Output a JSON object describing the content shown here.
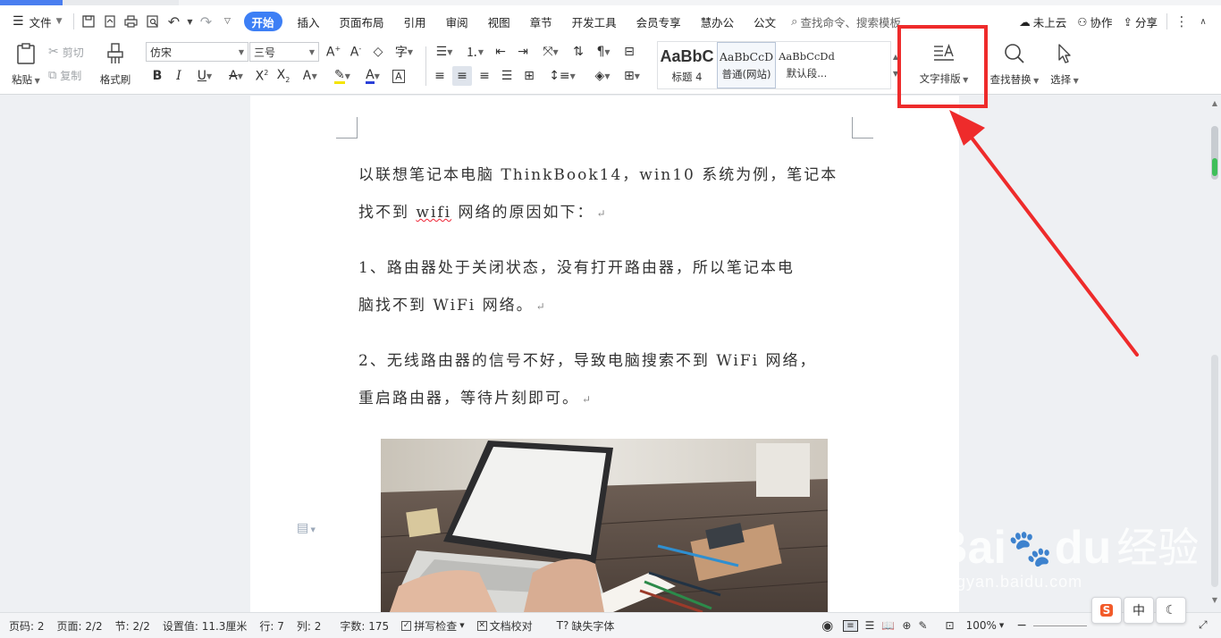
{
  "menubar": {
    "file_label": "文件",
    "tabs": [
      {
        "label": "开始",
        "active": true
      },
      {
        "label": "插入"
      },
      {
        "label": "页面布局"
      },
      {
        "label": "引用"
      },
      {
        "label": "审阅"
      },
      {
        "label": "视图"
      },
      {
        "label": "章节"
      },
      {
        "label": "开发工具"
      },
      {
        "label": "会员专享"
      },
      {
        "label": "慧办公"
      },
      {
        "label": "公文"
      }
    ],
    "search_label": "查找命令、搜索模板",
    "cloud_label": "未上云",
    "collab_label": "协作",
    "share_label": "分享"
  },
  "ribbon": {
    "paste_label": "粘贴",
    "cut_label": "剪切",
    "copy_label": "复制",
    "format_painter_label": "格式刷",
    "font_name": "仿宋",
    "font_size": "三号",
    "styles": [
      {
        "preview": "AaBbC",
        "name": "标题 4"
      },
      {
        "preview": "AaBbCcD",
        "name": "普通(网站)"
      },
      {
        "preview": "AaBbCcDd",
        "name": "默认段..."
      }
    ],
    "text_layout_label": "文字排版",
    "find_replace_label": "查找替换",
    "select_label": "选择"
  },
  "document": {
    "p1_line1": "以联想笔记本电脑 ThinkBook14，win10 系统为例，笔记本",
    "p1_line2_pre": "找不到 ",
    "p1_line2_wifi": "wifi",
    "p1_line2_post": " 网络的原因如下：",
    "p2_line1": "1、路由器处于关闭状态，没有打开路由器，所以笔记本电",
    "p2_line2": "脑找不到 WiFi 网络。",
    "p3_line1": "2、无线路由器的信号不好，导致电脑搜索不到 WiFi 网络，",
    "p3_line2": "重启路由器，等待片刻即可。",
    "return_mark": "↵"
  },
  "statusbar": {
    "page_num": "页码: 2",
    "pages": "页面: 2/2",
    "section": "节: 2/2",
    "setting": "设置值: 11.3厘米",
    "row": "行: 7",
    "col": "列: 2",
    "words": "字数: 175",
    "spell_check": "拼写检查",
    "doc_proof": "文档校对",
    "missing_font": "缺失字体",
    "zoom": "100%"
  },
  "watermark": {
    "brand": "Bai",
    "brand2": "du",
    "brand_cn": "经验",
    "url": "jingyan.baidu.com"
  },
  "ime": {
    "lang": "中"
  },
  "colors": {
    "accent": "#3d7ff5",
    "annotation_red": "#ee2b2b"
  }
}
